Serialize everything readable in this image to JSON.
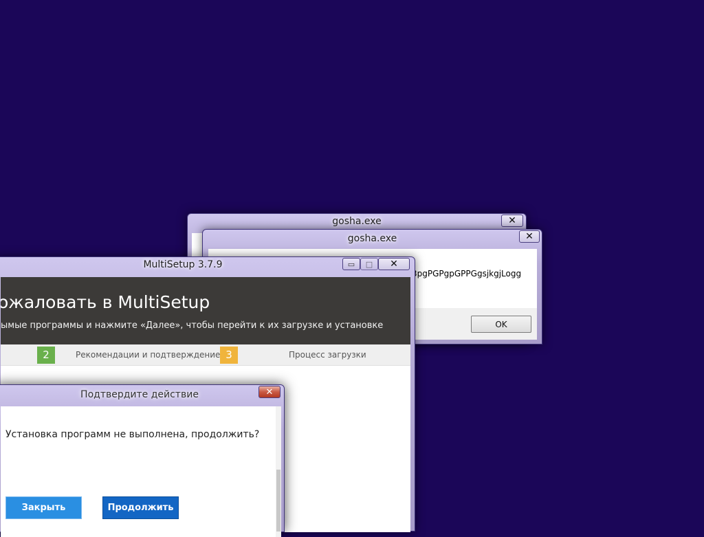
{
  "colors": {
    "desktop": "#1b0658",
    "header_bg": "#3c3a38",
    "step2": "#6ab04c",
    "step3": "#f0b43c",
    "button_blue": "#1f7fd6",
    "button_blue_dark": "#0e5fb4"
  },
  "gosha_back": {
    "title": "gosha.exe",
    "close_glyph": "✕"
  },
  "gosha_front": {
    "title": "gosha.exe",
    "close_glyph": "✕",
    "message": "3pgPGPgpGPPGgsjkgjLogg",
    "icon": "error-icon",
    "ok_label": "OK"
  },
  "multisetup": {
    "title": "MultiSetup 3.7.9",
    "minimize_glyph": "▭",
    "maximize_glyph": "□",
    "close_glyph": "✕",
    "heading": "ожаловать в MultiSetup",
    "subheading": "ымые программы и нажмите «Далее», чтобы перейти к их загрузке и установке",
    "steps": [
      {
        "number": "2",
        "label": "Рекомендации и подтверждение"
      },
      {
        "number": "3",
        "label": "Процесс загрузки"
      }
    ]
  },
  "confirm": {
    "title": "Подтвердите действие",
    "close_glyph": "✕",
    "message": "Установка программ не выполнена, продолжить?",
    "close_button": "Закрыть",
    "continue_button": "Продолжить"
  }
}
